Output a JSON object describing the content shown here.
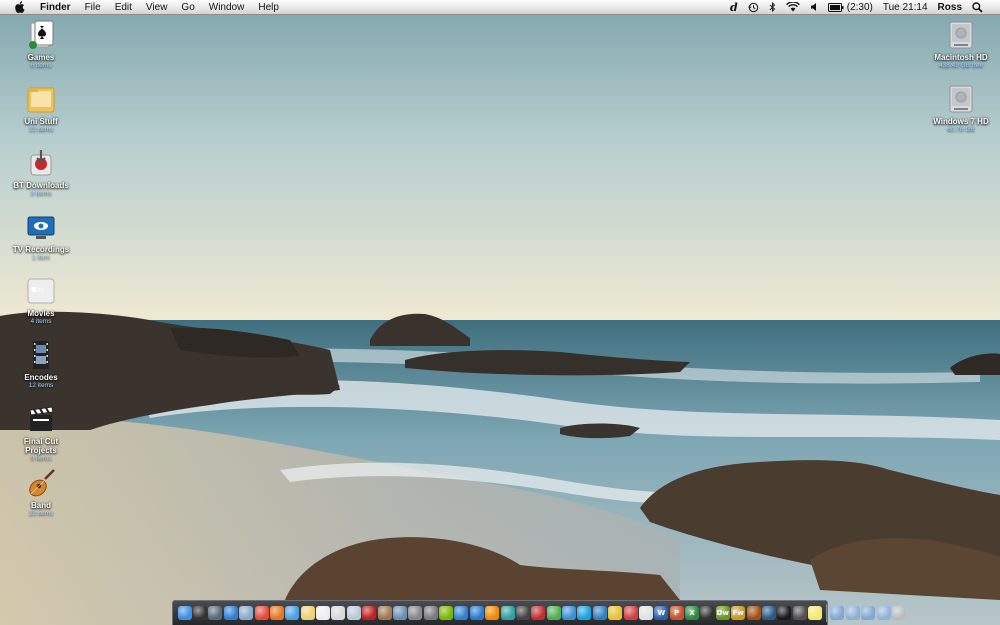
{
  "menubar": {
    "app_name": "Finder",
    "menus": [
      "File",
      "Edit",
      "View",
      "Go",
      "Window",
      "Help"
    ],
    "status": {
      "d_glyph": "d",
      "battery_text": "(2:30)",
      "clock": "Tue 21:14",
      "user": "Ross"
    },
    "icons": [
      "apple-icon",
      "time-machine-icon",
      "bluetooth-icon",
      "wifi-icon",
      "volume-icon",
      "battery-icon",
      "spotlight-icon"
    ]
  },
  "desktop": {
    "left_icons": [
      {
        "label": "Games",
        "sub": "6 items",
        "icon": "games-icon"
      },
      {
        "label": "Uni Stuff",
        "sub": "23 items",
        "icon": "folder-icon"
      },
      {
        "label": "BT Downloads",
        "sub": "3 items",
        "icon": "bt-downloads-icon"
      },
      {
        "label": "TV Recordings",
        "sub": "1 item",
        "icon": "tv-recordings-icon"
      },
      {
        "label": "Movies",
        "sub": "4 items",
        "icon": "apple-tv-icon"
      },
      {
        "label": "Encodes",
        "sub": "12 items",
        "icon": "film-strip-icon"
      },
      {
        "label": "Final Cut",
        "label2": "Projects",
        "sub": "9 items",
        "icon": "clapperboard-icon"
      },
      {
        "label": "Band",
        "sub": "23 items",
        "icon": "guitar-icon"
      }
    ],
    "right_icons": [
      {
        "label": "Macintosh HD",
        "sub": "438.49  GB free",
        "icon": "hard-drive-icon"
      },
      {
        "label": "Windows 7 HD",
        "sub": "60.76 GB",
        "icon": "hard-drive-icon"
      }
    ]
  },
  "dock": {
    "apps": [
      {
        "icon": "finder-icon",
        "color": "#3d8fe0"
      },
      {
        "icon": "dashboard-icon",
        "color": "#333333"
      },
      {
        "icon": "mission-control-icon",
        "color": "#5a6a7a"
      },
      {
        "icon": "safari-icon",
        "color": "#2f7fd6"
      },
      {
        "icon": "mail-icon",
        "color": "#8aa9c9"
      },
      {
        "icon": "chrome-icon",
        "color": "#e24a3b"
      },
      {
        "icon": "firefox-icon",
        "color": "#e5771e"
      },
      {
        "icon": "itunes-icon",
        "color": "#4aa0e0"
      },
      {
        "icon": "notes-icon",
        "color": "#f0d070"
      },
      {
        "icon": "calendar-icon",
        "color": "#eeeeee"
      },
      {
        "icon": "textedit-icon",
        "color": "#d8d8d8"
      },
      {
        "icon": "preview-icon",
        "color": "#b9c8d6"
      },
      {
        "icon": "photo-booth-icon",
        "color": "#c02020"
      },
      {
        "icon": "address-book-icon",
        "color": "#a07850"
      },
      {
        "icon": "iphoto-icon",
        "color": "#6b8fb0"
      },
      {
        "icon": "utilities-icon",
        "color": "#888888"
      },
      {
        "icon": "system-prefs-icon",
        "color": "#7a7a7a"
      },
      {
        "icon": "spotify-icon",
        "color": "#7ab800"
      },
      {
        "icon": "quicktime-icon",
        "color": "#3080d0"
      },
      {
        "icon": "app-store-icon",
        "color": "#2a7ad0"
      },
      {
        "icon": "vlc-icon",
        "color": "#f08a00"
      },
      {
        "icon": "activity-monitor-icon",
        "color": "#30a0a0"
      },
      {
        "icon": "camera-icon",
        "color": "#444444"
      },
      {
        "icon": "transmission-icon",
        "color": "#c03030"
      },
      {
        "icon": "adium-icon",
        "color": "#50b050"
      },
      {
        "icon": "ichat-icon",
        "color": "#3a90d8"
      },
      {
        "icon": "skype-icon",
        "color": "#1aa3e0"
      },
      {
        "icon": "messenger-icon",
        "color": "#3080c0"
      },
      {
        "icon": "smiley-icon",
        "color": "#e8c030"
      },
      {
        "icon": "colloquy-icon",
        "color": "#d04040"
      },
      {
        "icon": "script-editor-icon",
        "color": "#e0e0e0"
      },
      {
        "icon": "word-icon",
        "color": "#2a5fb0",
        "text": "W"
      },
      {
        "icon": "powerpoint-icon",
        "color": "#c8502a",
        "text": "P"
      },
      {
        "icon": "excel-icon",
        "color": "#2e8a3e",
        "text": "X"
      },
      {
        "icon": "final-cut-icon",
        "color": "#333333"
      },
      {
        "icon": "dreamweaver-icon",
        "color": "#6a9a20",
        "text": "Dw"
      },
      {
        "icon": "fireworks-icon",
        "color": "#c89a20",
        "text": "Fw"
      },
      {
        "icon": "illustrator-icon",
        "color": "#a05010"
      },
      {
        "icon": "xcode-icon",
        "color": "#2a5a8a"
      },
      {
        "icon": "terminal-icon",
        "color": "#1a1a1a"
      },
      {
        "icon": "console-icon",
        "color": "#505050"
      },
      {
        "icon": "stickies-icon",
        "color": "#f2e870"
      }
    ],
    "stack_items": [
      {
        "icon": "applications-stack-icon",
        "color": "#7fa8d0"
      },
      {
        "icon": "documents-stack-icon",
        "color": "#8fb0d4"
      },
      {
        "icon": "downloads-stack-icon",
        "color": "#80a8d0"
      },
      {
        "icon": "folder-stack-icon",
        "color": "#90b4d8"
      },
      {
        "icon": "trash-icon",
        "color": "#b8bcc0"
      }
    ]
  }
}
